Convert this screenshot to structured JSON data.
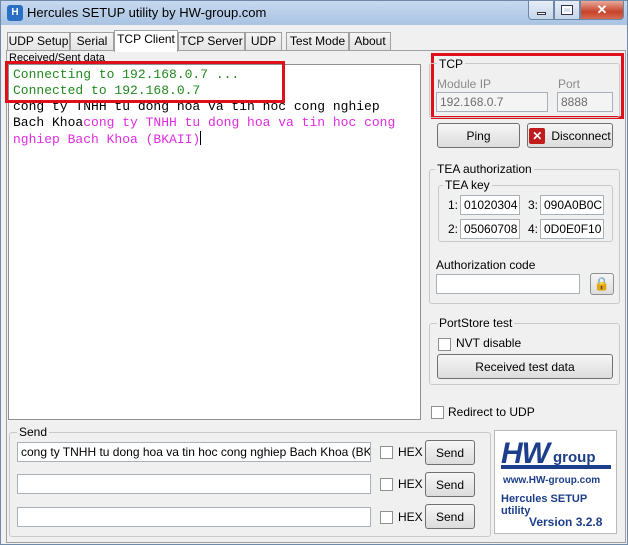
{
  "window": {
    "title": "Hercules SETUP utility by HW-group.com"
  },
  "titlebar": {
    "min_label": "",
    "max_label": "",
    "close_label": "✕"
  },
  "tabs": [
    {
      "label": "UDP Setup",
      "active": false
    },
    {
      "label": "Serial",
      "active": false
    },
    {
      "label": "TCP Client",
      "active": true
    },
    {
      "label": "TCP Server",
      "active": false
    },
    {
      "label": "UDP",
      "active": false
    },
    {
      "label": "Test Mode",
      "active": false
    },
    {
      "label": "About",
      "active": false
    }
  ],
  "received": {
    "label": "Received/Sent data",
    "lines": [
      {
        "parts": [
          {
            "text": "Connecting to 192.168.0.7 ...",
            "color": "green"
          }
        ]
      },
      {
        "parts": [
          {
            "text": "Connected to 192.168.0.7",
            "color": "green"
          }
        ]
      },
      {
        "parts": [
          {
            "text": "cong ty TNHH tu dong hoa va tin hoc cong nghiep",
            "color": "black"
          }
        ]
      },
      {
        "parts": [
          {
            "text": "Bach Khoa",
            "color": "black"
          },
          {
            "text": "cong ty TNHH tu dong hoa va tin hoc cong",
            "color": "magenta"
          }
        ]
      },
      {
        "parts": [
          {
            "text": "nghiep Bach Khoa (BKAII)",
            "color": "magenta"
          }
        ]
      }
    ]
  },
  "tcp": {
    "title": "TCP",
    "module_ip_label": "Module IP",
    "module_ip": "192.168.0.7",
    "port_label": "Port",
    "port": "8888",
    "ping_label": "Ping",
    "disconnect_label": "Disconnect"
  },
  "tea": {
    "title": "TEA authorization",
    "key_title": "TEA key",
    "keys": [
      {
        "index": "1:",
        "value": "01020304"
      },
      {
        "index": "3:",
        "value": "090A0B0C"
      },
      {
        "index": "2:",
        "value": "05060708"
      },
      {
        "index": "4:",
        "value": "0D0E0F10"
      }
    ],
    "auth_label": "Authorization code",
    "auth_value": ""
  },
  "portstore": {
    "title": "PortStore test",
    "nvt_label": "NVT disable",
    "received_button": "Received test data"
  },
  "redirect_label": "Redirect to UDP",
  "send": {
    "title": "Send",
    "hex_label": "HEX",
    "send_label": "Send",
    "rows": [
      {
        "value": "cong ty TNHH tu dong hoa va tin hoc cong nghiep Bach Khoa (BKAII)"
      },
      {
        "value": ""
      },
      {
        "value": ""
      }
    ]
  },
  "logo": {
    "hw": "HW",
    "group": "group",
    "www": "www.HW-group.com",
    "name": "Hercules SETUP utility",
    "version": "Version  3.2.8"
  },
  "colors": {
    "green": "#1f8a1f",
    "magenta": "#e02be0",
    "highlight_box": "#e0101a",
    "brand": "#1d3e8a"
  }
}
